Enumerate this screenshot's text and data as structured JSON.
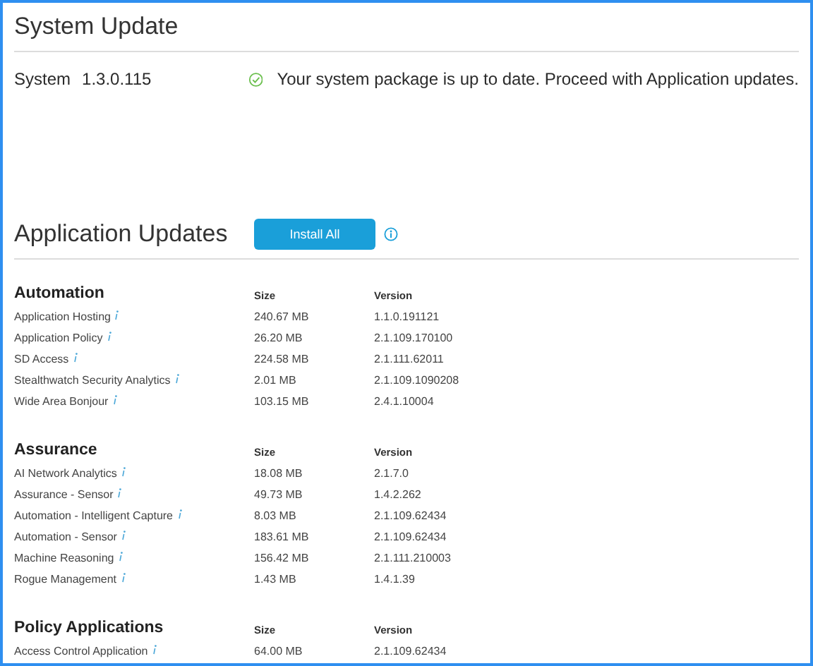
{
  "system_update": {
    "title": "System Update",
    "label": "System",
    "version": "1.3.0.115",
    "message": "Your system package is up to date. Proceed with Application updates."
  },
  "application_updates": {
    "title": "Application Updates",
    "button": "Install All"
  },
  "groups": [
    {
      "name": "Automation",
      "size_header": "Size",
      "version_header": "Version",
      "rows": [
        {
          "name": "Application Hosting",
          "size": "240.67 MB",
          "version": "1.1.0.191121"
        },
        {
          "name": "Application Policy",
          "size": "26.20 MB",
          "version": "2.1.109.170100"
        },
        {
          "name": "SD Access",
          "size": "224.58 MB",
          "version": "2.1.111.62011"
        },
        {
          "name": "Stealthwatch Security Analytics",
          "size": "2.01 MB",
          "version": "2.1.109.1090208"
        },
        {
          "name": "Wide Area Bonjour",
          "size": "103.15 MB",
          "version": "2.4.1.10004"
        }
      ]
    },
    {
      "name": "Assurance",
      "size_header": "Size",
      "version_header": "Version",
      "rows": [
        {
          "name": "AI Network Analytics",
          "size": "18.08 MB",
          "version": "2.1.7.0"
        },
        {
          "name": "Assurance - Sensor",
          "size": "49.73 MB",
          "version": "1.4.2.262"
        },
        {
          "name": "Automation - Intelligent Capture",
          "size": "8.03 MB",
          "version": "2.1.109.62434"
        },
        {
          "name": "Automation - Sensor",
          "size": "183.61 MB",
          "version": "2.1.109.62434"
        },
        {
          "name": "Machine Reasoning",
          "size": "156.42 MB",
          "version": "2.1.111.210003"
        },
        {
          "name": "Rogue Management",
          "size": "1.43 MB",
          "version": "1.4.1.39"
        }
      ]
    },
    {
      "name": "Policy Applications",
      "size_header": "Size",
      "version_header": "Version",
      "rows": [
        {
          "name": "Access Control Application",
          "size": "64.00 MB",
          "version": "2.1.109.62434"
        }
      ]
    }
  ]
}
